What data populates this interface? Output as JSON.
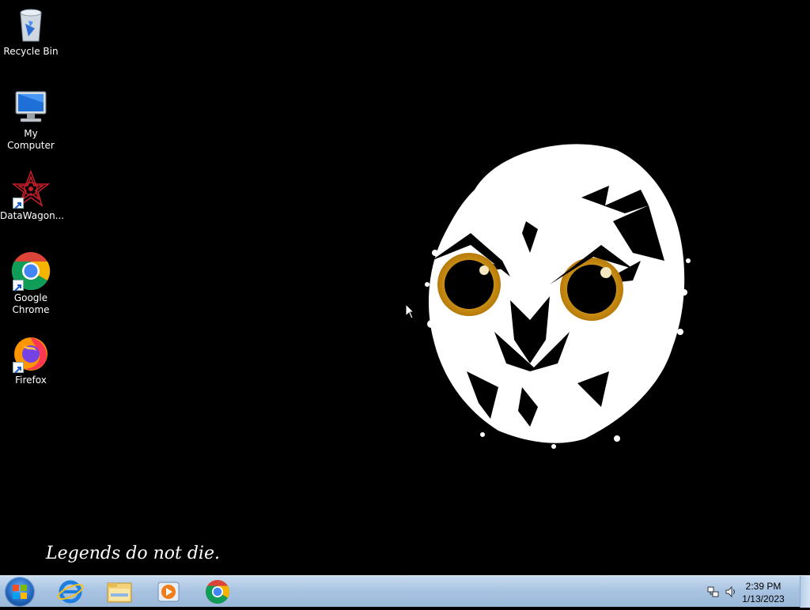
{
  "desktop": {
    "icons": [
      {
        "label": "Recycle Bin",
        "icon": "recycle-bin-icon"
      },
      {
        "label": "My Computer",
        "icon": "computer-icon"
      },
      {
        "label": "DataWagon...",
        "icon": "datawagon-icon"
      },
      {
        "label": "Google Chrome",
        "icon": "chrome-icon"
      },
      {
        "label": "Firefox",
        "icon": "firefox-icon"
      }
    ],
    "wallpaper_text": "Legends do not die."
  },
  "taskbar": {
    "start_icon": "windows-start-icon",
    "pinned": [
      {
        "name": "Internet Explorer",
        "icon": "internet-explorer-icon"
      },
      {
        "name": "Windows Explorer",
        "icon": "folder-icon"
      },
      {
        "name": "Windows Media Player",
        "icon": "media-player-icon"
      },
      {
        "name": "Google Chrome",
        "icon": "chrome-icon"
      }
    ],
    "clock": {
      "time": "2:39 PM",
      "date": "1/13/2023"
    }
  },
  "colors": {
    "taskbar": "#a9c4e2",
    "wallpaper_bg": "#000000",
    "owl_eye": "#e0a010"
  }
}
